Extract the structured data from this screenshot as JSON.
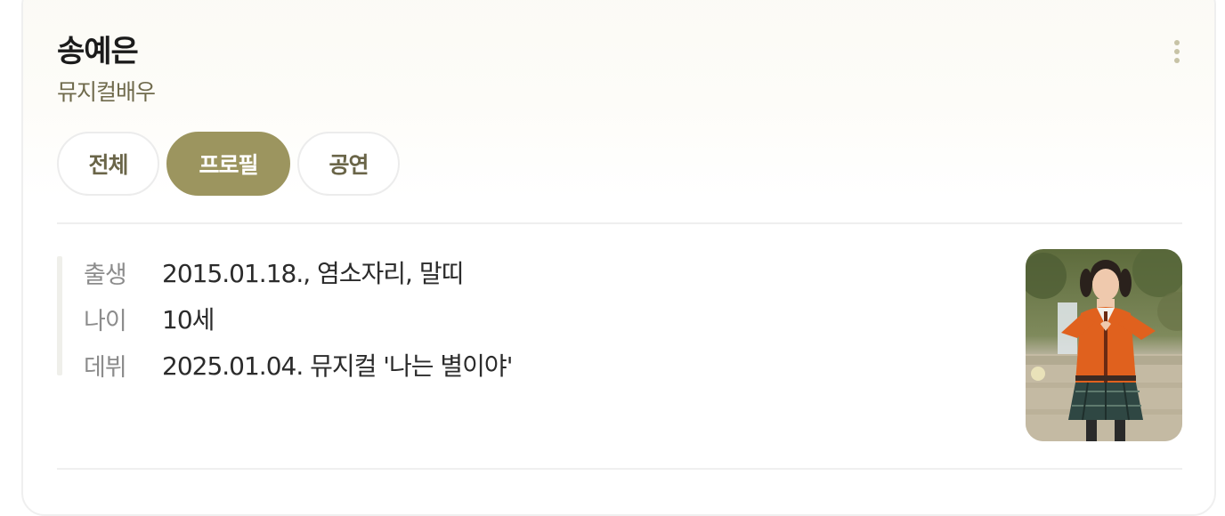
{
  "profile": {
    "name": "송예은",
    "subtitle": "뮤지컬배우"
  },
  "menu": {
    "icon": "more-vertical-icon"
  },
  "tabs": [
    {
      "label": "전체",
      "selected": false
    },
    {
      "label": "프로필",
      "selected": true
    },
    {
      "label": "공연",
      "selected": false
    }
  ],
  "info": {
    "rows": [
      {
        "label": "출생",
        "value": "2015.01.18., 염소자리, 말띠"
      },
      {
        "label": "나이",
        "value": "10세"
      },
      {
        "label": "데뷔",
        "value": "2025.01.04. 뮤지컬 '나는 별이야'"
      }
    ]
  },
  "colors": {
    "accent": "#9c955f",
    "subtitle": "#6f6a4c",
    "border": "#efefef"
  }
}
